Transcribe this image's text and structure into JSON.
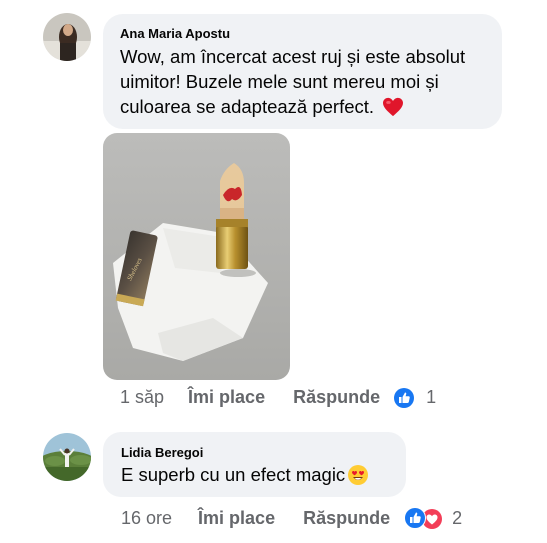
{
  "comments": [
    {
      "author": "Ana Maria Apostu",
      "text_line1": "Wow, am încercat acest ruj și este absolut",
      "text_line2": "uimitor! Buzele mele sunt mereu moi și",
      "text_line3": "culoarea se adaptează perfect.",
      "emoji": "heart-emoji",
      "time": "1 săp",
      "like_label": "Îmi place",
      "reply_label": "Răspunde",
      "reaction_count": "1",
      "reactions": [
        "like"
      ]
    },
    {
      "author": "Lidia Beregoi",
      "text": "E superb cu un efect magic",
      "emoji": "heart-eyes-emoji",
      "time": "16 ore",
      "like_label": "Îmi place",
      "reply_label": "Răspunde",
      "reaction_count": "2",
      "reactions": [
        "like",
        "love"
      ]
    }
  ],
  "colors": {
    "bubble": "#f0f2f5",
    "like_blue": "#1877f2",
    "love_red": "#f33e58",
    "meta_gray": "#65676b"
  }
}
